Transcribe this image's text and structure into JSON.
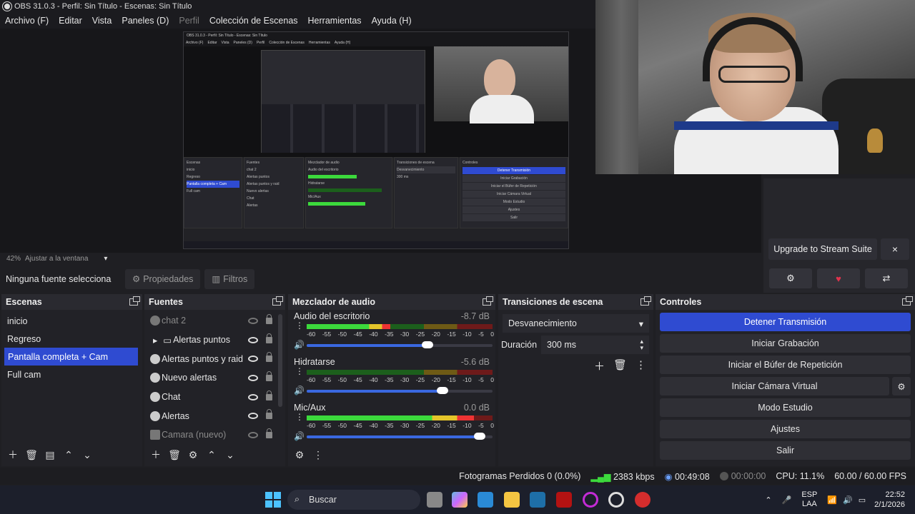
{
  "window": {
    "title": "OBS 31.0.3 - Perfil: Sin Título - Escenas: Sin Título"
  },
  "menu": [
    "Archivo (F)",
    "Editar",
    "Vista",
    "Paneles (D)",
    "Perfil",
    "Colección de Escenas",
    "Herramientas",
    "Ayuda (H)"
  ],
  "preview": {
    "zoom": "42%",
    "fit_label": "Ajustar a la ventana"
  },
  "source_toolbar": {
    "no_source": "Ninguna fuente selecciona",
    "properties": "Propiedades",
    "filters": "Filtros"
  },
  "stream_suite": {
    "upgrade_label": "Upgrade to Stream Suite",
    "close": "×"
  },
  "scenes": {
    "title": "Escenas",
    "items": [
      "inicio",
      "Regreso",
      "Pantalla completa + Cam",
      "Full cam"
    ],
    "selected_index": 2
  },
  "sources": {
    "title": "Fuentes",
    "items": [
      {
        "name": "chat 2",
        "visible": false
      },
      {
        "name": "Alertas puntos",
        "visible": true
      },
      {
        "name": "Alertas puntos y raid",
        "visible": true
      },
      {
        "name": "Nuevo alertas",
        "visible": true
      },
      {
        "name": "Chat",
        "visible": true
      },
      {
        "name": "Alertas",
        "visible": true
      },
      {
        "name": "Camara (nuevo)",
        "visible": false
      }
    ]
  },
  "mixer": {
    "title": "Mezclador de audio",
    "ticks": [
      "-60",
      "-55",
      "-50",
      "-45",
      "-40",
      "-35",
      "-30",
      "-25",
      "-20",
      "-15",
      "-10",
      "-5",
      "0"
    ],
    "channels": [
      {
        "name": "Audio del escritorio",
        "db": "-8.7 dB",
        "level": 0.45,
        "volume": 0.65
      },
      {
        "name": "Hidratarse",
        "db": "-5.6 dB",
        "level": 0.0,
        "volume": 0.73
      },
      {
        "name": "Mic/Aux",
        "db": "0.0 dB",
        "level": 0.9,
        "volume": 0.93
      }
    ]
  },
  "transitions": {
    "title": "Transiciones de escena",
    "selected": "Desvanecimiento",
    "duration_label": "Duración",
    "duration_value": "300 ms"
  },
  "controls": {
    "title": "Controles",
    "buttons": [
      "Detener Transmisión",
      "Iniciar Grabación",
      "Iniciar el Búfer de Repetición",
      "Iniciar Cámara Virtual",
      "Modo Estudio",
      "Ajustes",
      "Salir"
    ]
  },
  "status": {
    "dropped": "Fotogramas Perdidos 0 (0.0%)",
    "kbps": "2383 kbps",
    "stream_time": "00:49:08",
    "rec_time": "00:00:00",
    "cpu": "CPU: 11.1%",
    "fps": "60.00 / 60.00 FPS"
  },
  "taskbar": {
    "search": "Buscar",
    "lang_top": "ESP",
    "lang_bottom": "LAA",
    "time": "22:52",
    "date": "2/1/2026"
  },
  "colors": {
    "accent": "#2f4bd1",
    "panel": "#222227",
    "panel_header": "#2a2a30"
  }
}
